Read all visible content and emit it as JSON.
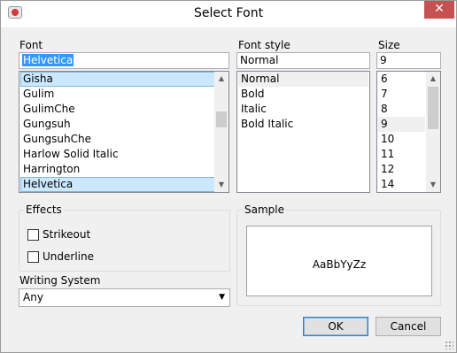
{
  "window": {
    "title": "Select Font"
  },
  "font": {
    "label": "Font",
    "value": "Helvetica",
    "items": [
      "Gisha",
      "Gulim",
      "GulimChe",
      "Gungsuh",
      "GungsuhChe",
      "Harlow Solid Italic",
      "Harrington",
      "Helvetica"
    ],
    "selected": "Helvetica"
  },
  "font_style": {
    "label": "Font style",
    "value": "Normal",
    "items": [
      "Normal",
      "Bold",
      "Italic",
      "Bold Italic"
    ],
    "selected": "Normal"
  },
  "size": {
    "label": "Size",
    "value": "9",
    "items": [
      "6",
      "7",
      "8",
      "9",
      "10",
      "11",
      "12",
      "14"
    ],
    "selected": "9"
  },
  "effects": {
    "label": "Effects",
    "strikeout": {
      "label": "Strikeout",
      "checked": false
    },
    "underline": {
      "label": "Underline",
      "checked": false
    }
  },
  "sample": {
    "label": "Sample",
    "text": "AaBbYyZz"
  },
  "writing_system": {
    "label": "Writing System",
    "value": "Any"
  },
  "buttons": {
    "ok": "OK",
    "cancel": "Cancel"
  },
  "icons": {
    "close": "close-icon",
    "app": "app-icon",
    "dropdown": "chevron-down-icon"
  },
  "colors": {
    "selection": "#3399ff",
    "list_highlight": "#cce8ff",
    "close_button": "#c75050"
  }
}
